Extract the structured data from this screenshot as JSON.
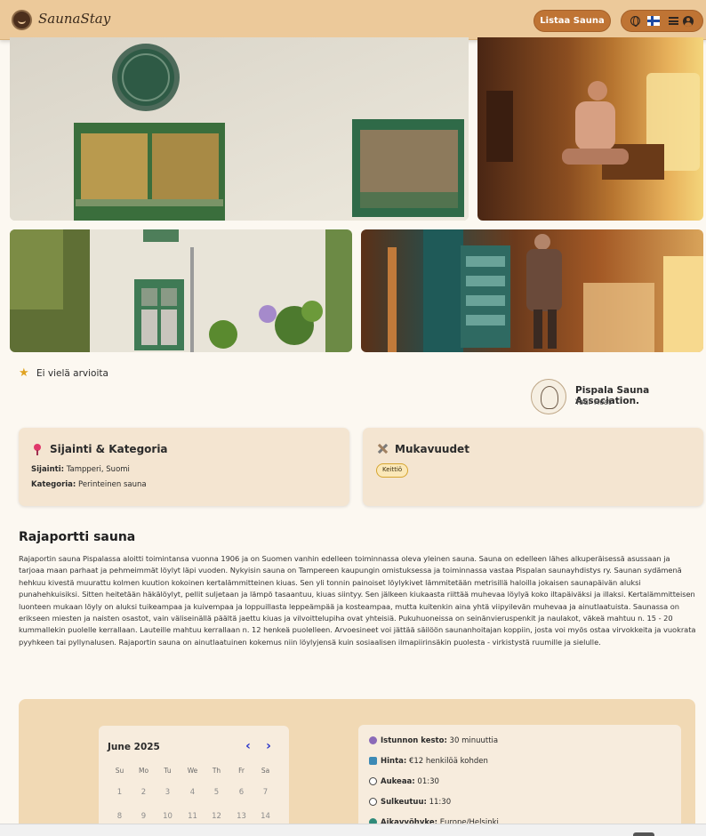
{
  "header": {
    "brand": "SaunaStay",
    "list_button": "Listaa Sauna",
    "icons": [
      "globe-icon",
      "finland-flag-icon",
      "menu-icon",
      "user-icon"
    ]
  },
  "gallery": [
    {
      "alt": "sauna-building-window"
    },
    {
      "alt": "sauna-ice-lights"
    },
    {
      "alt": "sauna-courtyard"
    },
    {
      "alt": "sauna-door-winter"
    }
  ],
  "rating": {
    "text": "Ei vielä arvioita"
  },
  "host": {
    "name": "Pispala Sauna Association.",
    "role": "Your Host"
  },
  "location_card": {
    "title": "Sijainti & Kategoria",
    "location_label": "Sijainti:",
    "location_value": "Tampperi, Suomi",
    "category_label": "Kategoria:",
    "category_value": "Perinteinen sauna"
  },
  "amenities_card": {
    "title": "Mukavuudet",
    "tags": [
      "Keittiö"
    ]
  },
  "sauna": {
    "title": "Rajaportti sauna",
    "description": "Rajaportin sauna Pispalassa aloitti toimintansa vuonna 1906 ja on Suomen vanhin edelleen toiminnassa oleva yleinen sauna. Sauna on edelleen lähes alkuperäisessä asussaan ja tarjoaa maan parhaat ja pehmeimmät löylyt läpi vuoden. Nykyisin sauna on Tampereen kaupungin omistuksessa ja toiminnassa vastaa Pispalan saunayhdistys ry. Saunan sydämenä hehkuu kivestä muurattu kolmen kuution kokoinen kertalämmitteinen kiuas. Sen yli tonnin painoiset löylykivet lämmitetään metrisillä haloilla jokaisen saunapäivän aluksi punahehkuisiksi. Sitten heitetään häkälöylyt, pellit suljetaan ja lämpö tasaantuu, kiuas siintyy. Sen jälkeen kiukaasta riittää muhevaa löylyä koko iltapäiväksi ja illaksi. Kertalämmitteisen luonteen mukaan löyly on aluksi tuikeampaa ja kuivempaa ja loppuillasta leppeämpää ja kosteampaa, mutta kuitenkin aina yhtä viipyilevän muhevaa ja ainutlaatuista. Saunassa on erikseen miesten ja naisten osastot, vain väliseinällä päältä jaettu kiuas ja vilvoittelupiha ovat yhteisiä. Pukuhuoneissa on seinänvieruspenkit ja naulakot, väkeä mahtuu n. 15 - 20 kummallekin puolelle kerrallaan. Lauteille mahtuu kerrallaan n. 12 henkeä puolelleen. Arvoesineet voi jättää säilöön saunanhoitajan koppiin, josta voi myös ostaa virvokkeita ja vuokrata pyyhkeen tai pyllynalusen. Rajaportin sauna on ainutlaatuinen kokemus niin löylyjensä kuin sosiaalisen ilmapiirinsäkin puolesta - virkistystä ruumille ja sielulle."
  },
  "calendar": {
    "month": "June 2025",
    "prev": "‹",
    "next": "›",
    "weekdays": [
      "Su",
      "Mo",
      "Tu",
      "We",
      "Th",
      "Fr",
      "Sa"
    ],
    "days": [
      [
        "1",
        "2",
        "3",
        "4",
        "5",
        "6",
        "7"
      ],
      [
        "8",
        "9",
        "10",
        "11",
        "12",
        "13",
        "14"
      ]
    ]
  },
  "booking_info": [
    {
      "icon": "stopwatch-icon",
      "label": "Istunnon kesto:",
      "value": "30 minuuttia"
    },
    {
      "icon": "money-icon",
      "label": "Hinta:",
      "value": "€12 henkilöä kohden"
    },
    {
      "icon": "clock-open-icon",
      "label": "Aukeaa:",
      "value": "01:30"
    },
    {
      "icon": "clock-close-icon",
      "label": "Sulkeutuu:",
      "value": "11:30"
    },
    {
      "icon": "globe-timezone-icon",
      "label": "Aikavyöhyke:",
      "value": "Europe/Helsinki"
    }
  ],
  "colors": {
    "header_bg": "#ecc99a",
    "accent": "#bf7434",
    "card_bg": "#f4e5d1",
    "booking_bg": "#f1d9b4",
    "calendar_nav": "#2a35c9"
  }
}
